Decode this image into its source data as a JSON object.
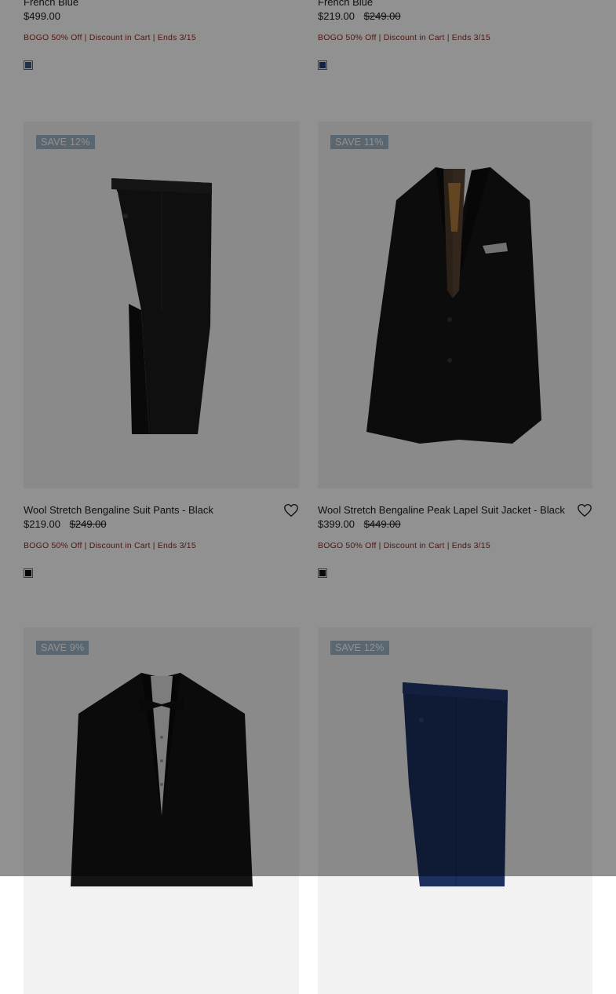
{
  "products_top": [
    {
      "color_name": "French Blue",
      "price": "$499.00",
      "original_price": "",
      "promo": "BOGO 50% Off | Discount in Cart | Ends 3/15",
      "swatch_color": "#3c5a86"
    },
    {
      "color_name": "French Blue",
      "price": "$219.00",
      "original_price": "$249.00",
      "promo": "BOGO 50% Off | Discount in Cart | Ends 3/15",
      "swatch_color": "#1f3c78"
    }
  ],
  "products_row1": [
    {
      "badge": "SAVE 12%",
      "title": "Wool Stretch Bengaline Suit Pants - Black",
      "price": "$219.00",
      "original_price": "$249.00",
      "promo": "BOGO 50% Off | Discount in Cart | Ends 3/15",
      "swatch_color": "#111111",
      "icon": "heart-icon"
    },
    {
      "badge": "SAVE 11%",
      "title": "Wool Stretch Bengaline Peak Lapel Suit Jacket - Black",
      "price": "$399.00",
      "original_price": "$449.00",
      "promo": "BOGO 50% Off | Discount in Cart | Ends 3/15",
      "swatch_color": "#111111",
      "icon": "heart-icon"
    }
  ],
  "products_row2": [
    {
      "badge": "SAVE 9%"
    },
    {
      "badge": "SAVE 12%"
    }
  ],
  "colors": {
    "overlay": "rgba(0,0,0,0.43)",
    "badge_bg": "#9fb5c6",
    "promo_text": "#8a2a1f",
    "image_bg": "#f2f2f2"
  }
}
